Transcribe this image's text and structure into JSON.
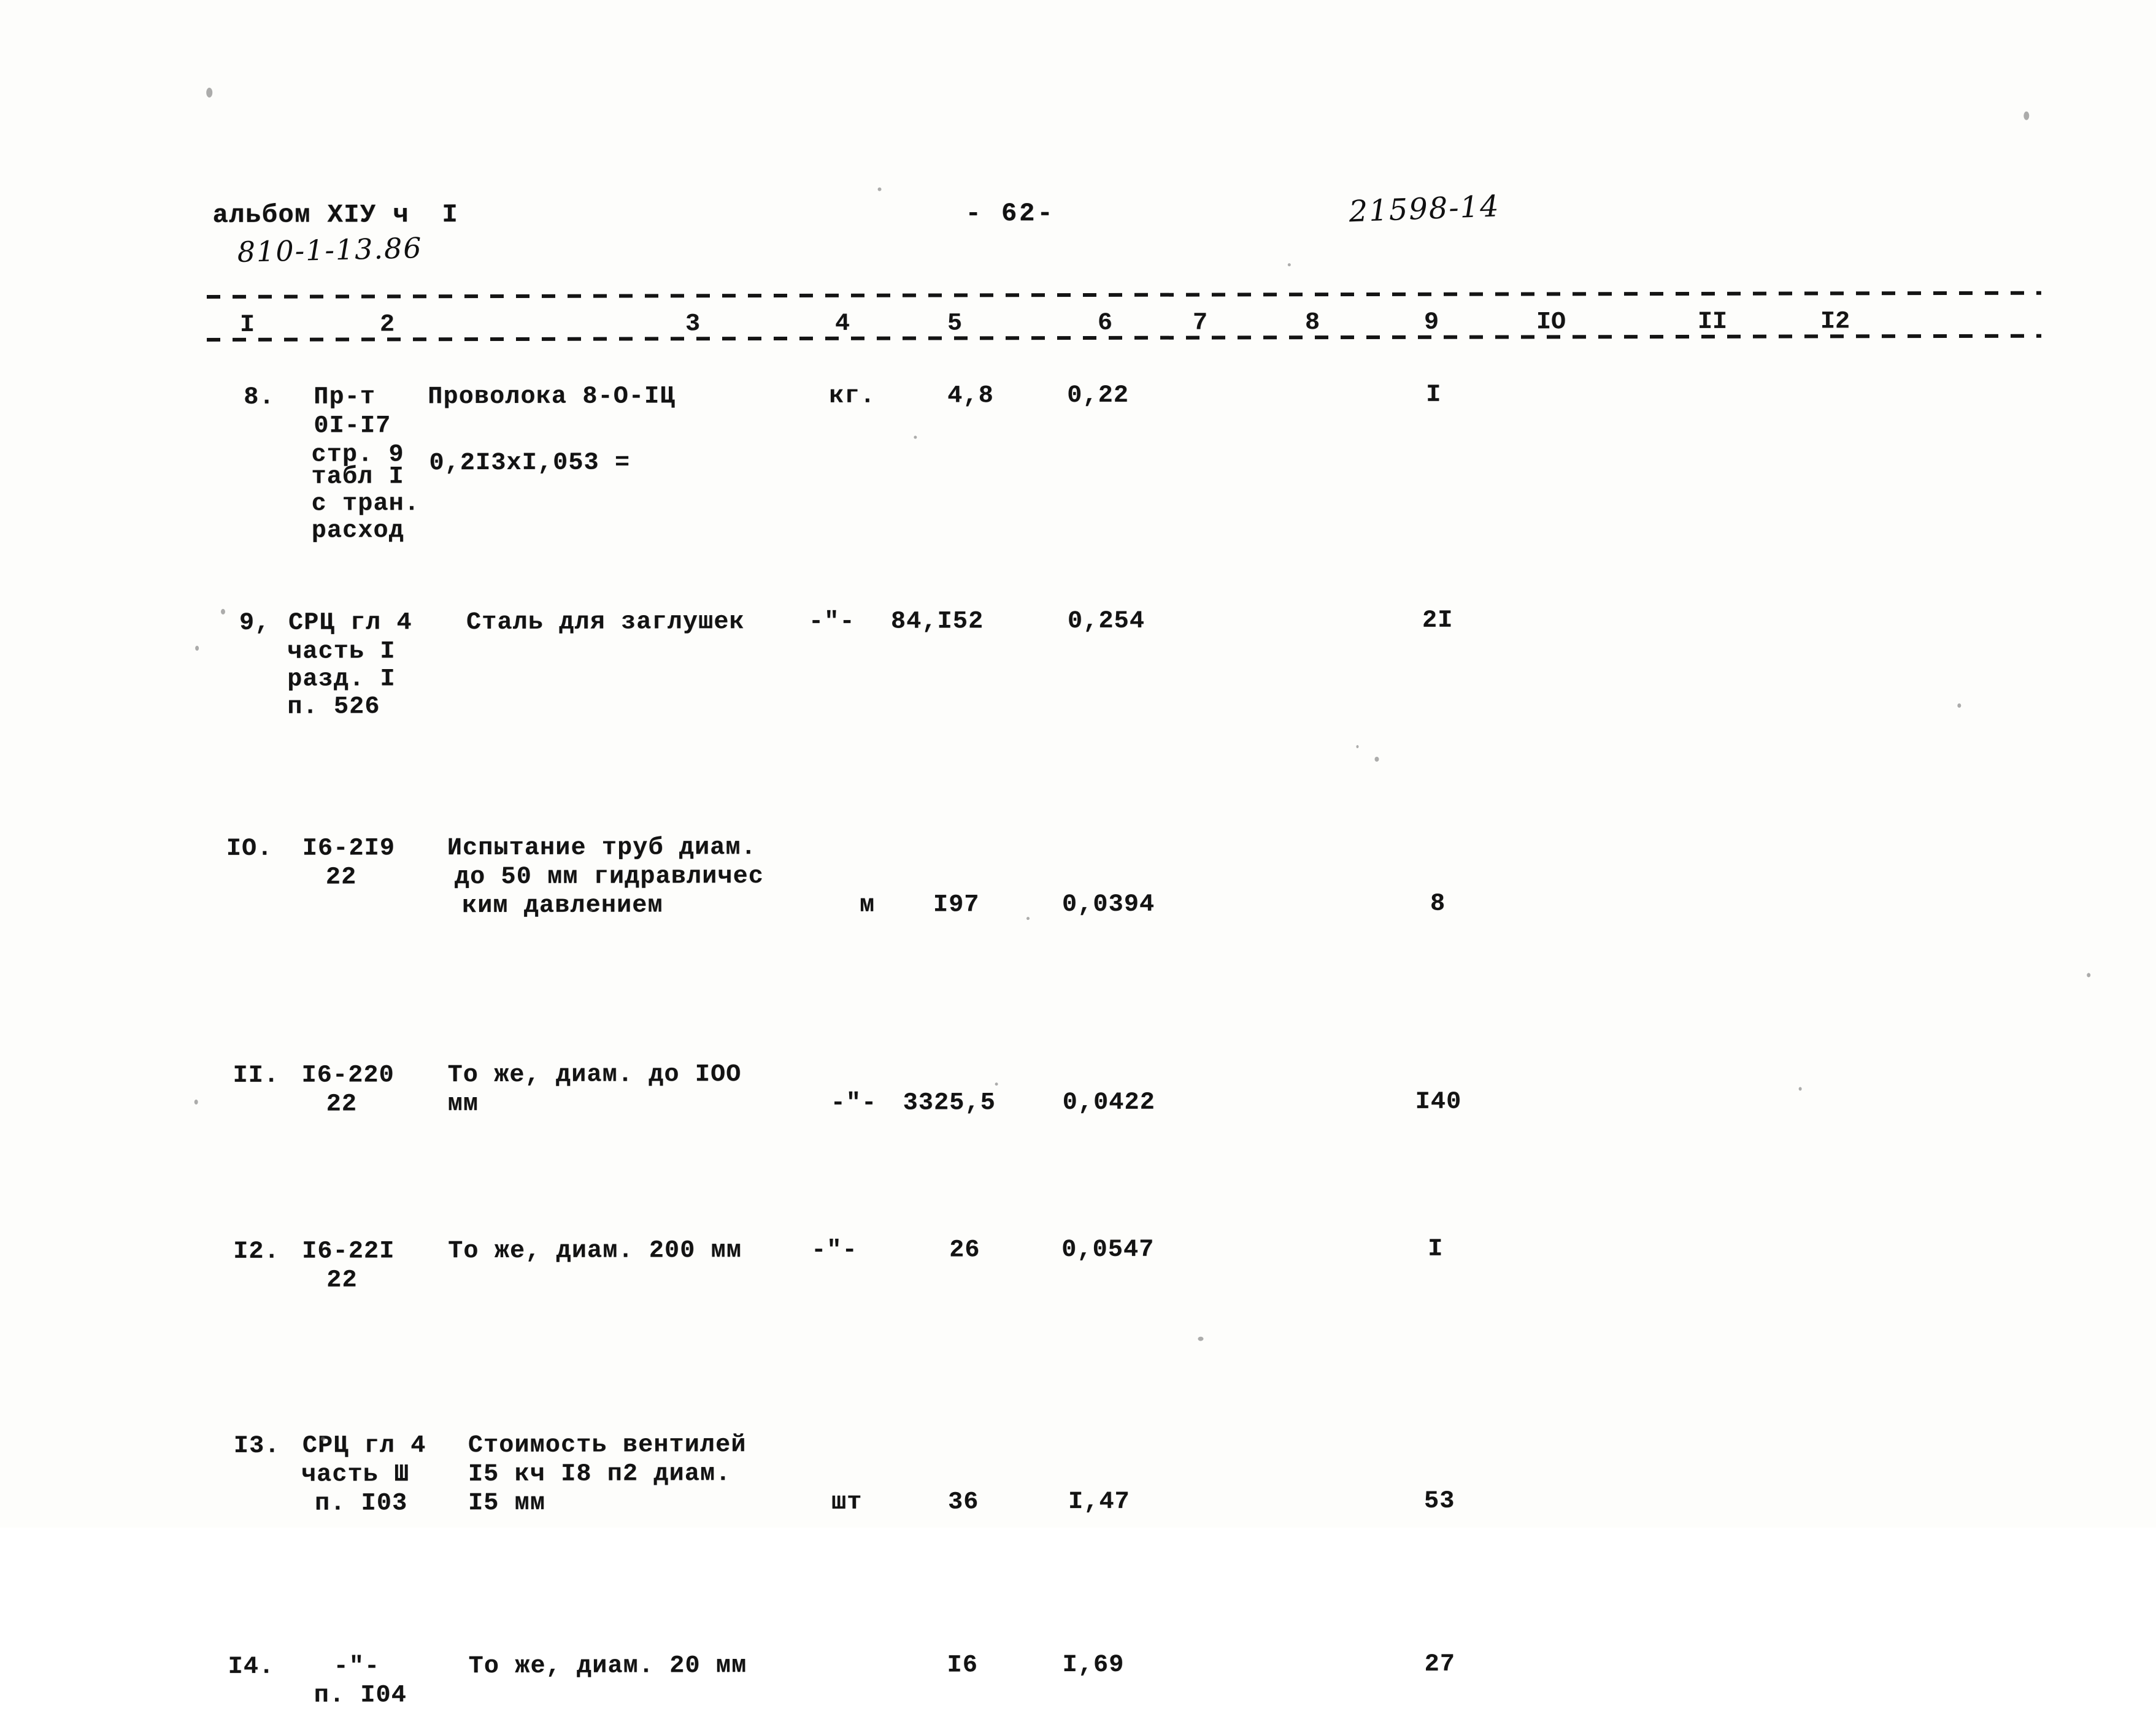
{
  "document": {
    "header": {
      "album_line": "альбом XIУ ч  I",
      "album_code_handwritten": "810-1-13.86",
      "page_number": "- 62-",
      "doc_number_handwritten": "21598-14"
    },
    "column_numbers": [
      "I",
      "2",
      "3",
      "4",
      "5",
      "6",
      "7",
      "8",
      "9",
      "IO",
      "II",
      "I2"
    ],
    "rows": [
      {
        "index": "8.",
        "code_lines": [
          "Пр-т",
          "0I-I7",
          "стр. 9",
          "табл I",
          "с тран.",
          "расход"
        ],
        "description": "Проволока 8-О-IЦ",
        "description_extra": "0,2I3xI,053 =",
        "unit": "кг.",
        "quantity": "4,8",
        "price": "0,22",
        "total": "I"
      },
      {
        "index": "9,",
        "code_lines": [
          "СРЦ гл 4",
          "часть I",
          "разд. I",
          "п. 526"
        ],
        "description": "Сталь для заглушек",
        "unit": "-\"-",
        "quantity": "84,I52",
        "price": "0,254",
        "total": "2I"
      },
      {
        "index": "IO.",
        "code_lines": [
          "I6-2I9",
          "22"
        ],
        "description_lines": [
          "Испытание труб диам.",
          "до 50 мм гидравличес",
          "ким давлением"
        ],
        "unit": "м",
        "quantity": "I97",
        "price": "0,0394",
        "total": "8"
      },
      {
        "index": "II.",
        "code_lines": [
          "I6-220",
          "22"
        ],
        "description_lines": [
          "То же, диам. до IOO",
          "мм"
        ],
        "unit": "-\"-",
        "quantity": "3325,5",
        "price": "0,0422",
        "total": "I40"
      },
      {
        "index": "I2.",
        "code_lines": [
          "I6-22I",
          "22"
        ],
        "description_lines": [
          "То же, диам. 200 мм"
        ],
        "unit": "-\"-",
        "quantity": "26",
        "price": "0,0547",
        "total": "I"
      },
      {
        "index": "I3.",
        "code_lines": [
          "СРЦ гл 4",
          "часть Ш",
          "п. I03"
        ],
        "description_lines": [
          "Стоимость вентилей",
          "I5 кч I8 п2 диам.",
          "I5 мм"
        ],
        "unit": "шт",
        "quantity": "36",
        "price": "I,47",
        "total": "53"
      },
      {
        "index": "I4.",
        "code_lines": [
          "-\"-",
          "п. I04"
        ],
        "description_lines": [
          "То же, диам. 20 мм"
        ],
        "unit": "",
        "quantity": "I6",
        "price": "I,69",
        "total": "27"
      }
    ]
  }
}
